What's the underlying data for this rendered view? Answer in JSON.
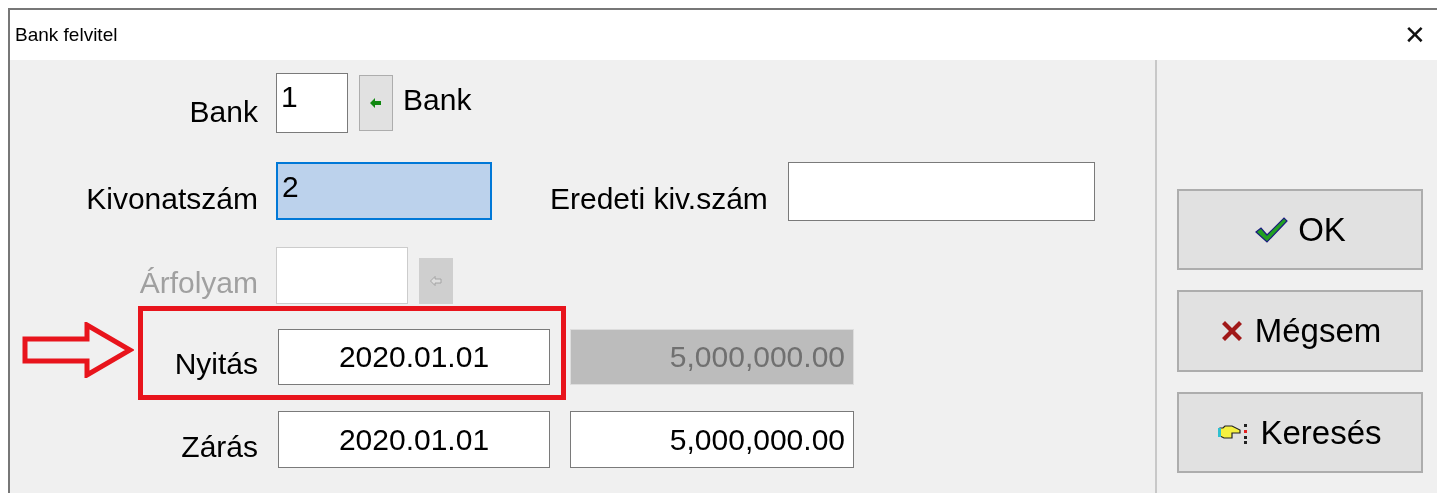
{
  "window": {
    "title": "Bank felvitel",
    "close": "✕"
  },
  "form": {
    "bank": {
      "label": "Bank",
      "value": "1",
      "lookup_disabled": false,
      "lookup_name": "Bank"
    },
    "statement_number": {
      "label": "Kivonatszám",
      "value": "2",
      "selected": true
    },
    "original_number": {
      "label": "Eredeti kiv.szám"
    },
    "exchange_rate": {
      "label": "Árfolyam",
      "disabled": true
    },
    "opening": {
      "label": "Nyitás",
      "date": "2020.01.01",
      "amount": "5,000,000.00",
      "amount_disabled": true
    },
    "closing": {
      "label": "Zárás",
      "date": "2020.01.01",
      "amount": "5,000,000.00",
      "amount_disabled": false
    }
  },
  "buttons": [
    {
      "label": "OK",
      "kind": "ok"
    },
    {
      "label": "Mégsem",
      "kind": "cancel"
    },
    {
      "label": "Keresés",
      "kind": "search"
    }
  ],
  "annotation": {
    "kind": "arrow-box"
  }
}
